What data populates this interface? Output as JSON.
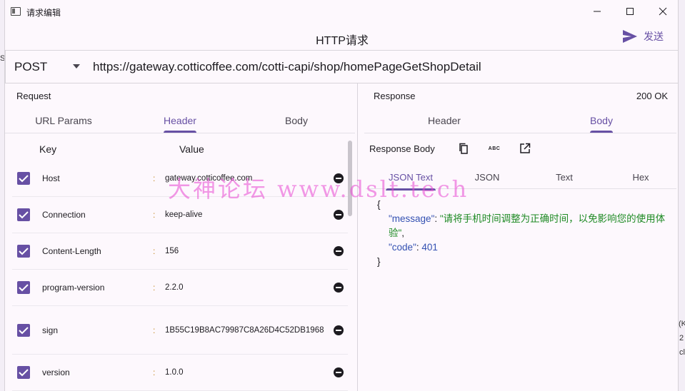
{
  "window": {
    "title": "请求编辑",
    "minimize_icon": "minimize-icon",
    "maximize_icon": "maximize-icon",
    "close_icon": "close-icon"
  },
  "header": {
    "title": "HTTP请求",
    "send_label": "发送",
    "send_icon": "send-icon"
  },
  "request_line": {
    "method": "POST",
    "url": "https://gateway.cotticoffee.com/cotti-capi/shop/homePageGetShopDetail"
  },
  "request": {
    "label": "Request",
    "tabs": [
      {
        "label": "URL Params",
        "active": false
      },
      {
        "label": "Header",
        "active": true
      },
      {
        "label": "Body",
        "active": false
      }
    ],
    "columns": {
      "key": "Key",
      "value": "Value"
    },
    "headers": [
      {
        "key": "Host",
        "value": "gateway.cotticoffee.com",
        "checked": true
      },
      {
        "key": "Connection",
        "value": "keep-alive",
        "checked": true
      },
      {
        "key": "Content-Length",
        "value": "156",
        "checked": true
      },
      {
        "key": "program-version",
        "value": "2.2.0",
        "checked": true
      },
      {
        "key": "sign",
        "value": "1B55C19B8AC79987C8A26D4C52DB1968",
        "checked": true
      },
      {
        "key": "version",
        "value": "1.0.0",
        "checked": true
      }
    ],
    "separator": ":"
  },
  "response": {
    "label": "Response",
    "status": "200  OK",
    "tabs": [
      {
        "label": "Header",
        "active": false
      },
      {
        "label": "Body",
        "active": true
      }
    ],
    "body_label": "Response Body",
    "abc_label": "ABC",
    "sub_tabs": [
      {
        "label": "JSON Text",
        "active": true
      },
      {
        "label": "JSON",
        "active": false
      },
      {
        "label": "Text",
        "active": false
      },
      {
        "label": "Hex",
        "active": false
      }
    ],
    "json": {
      "open": "{",
      "close": "}",
      "message_key": "\"message\"",
      "message_value": "\"请将手机时间调整为正确时间，以免影响您的使用体验\"",
      "code_key": "\"code\"",
      "code_value": "401"
    }
  },
  "watermark": "大神论坛  www.dslt.tech",
  "edge_text": {
    "left_char": "S",
    "right_1": "(K",
    "right_2": "2",
    "right_3": "cl"
  }
}
